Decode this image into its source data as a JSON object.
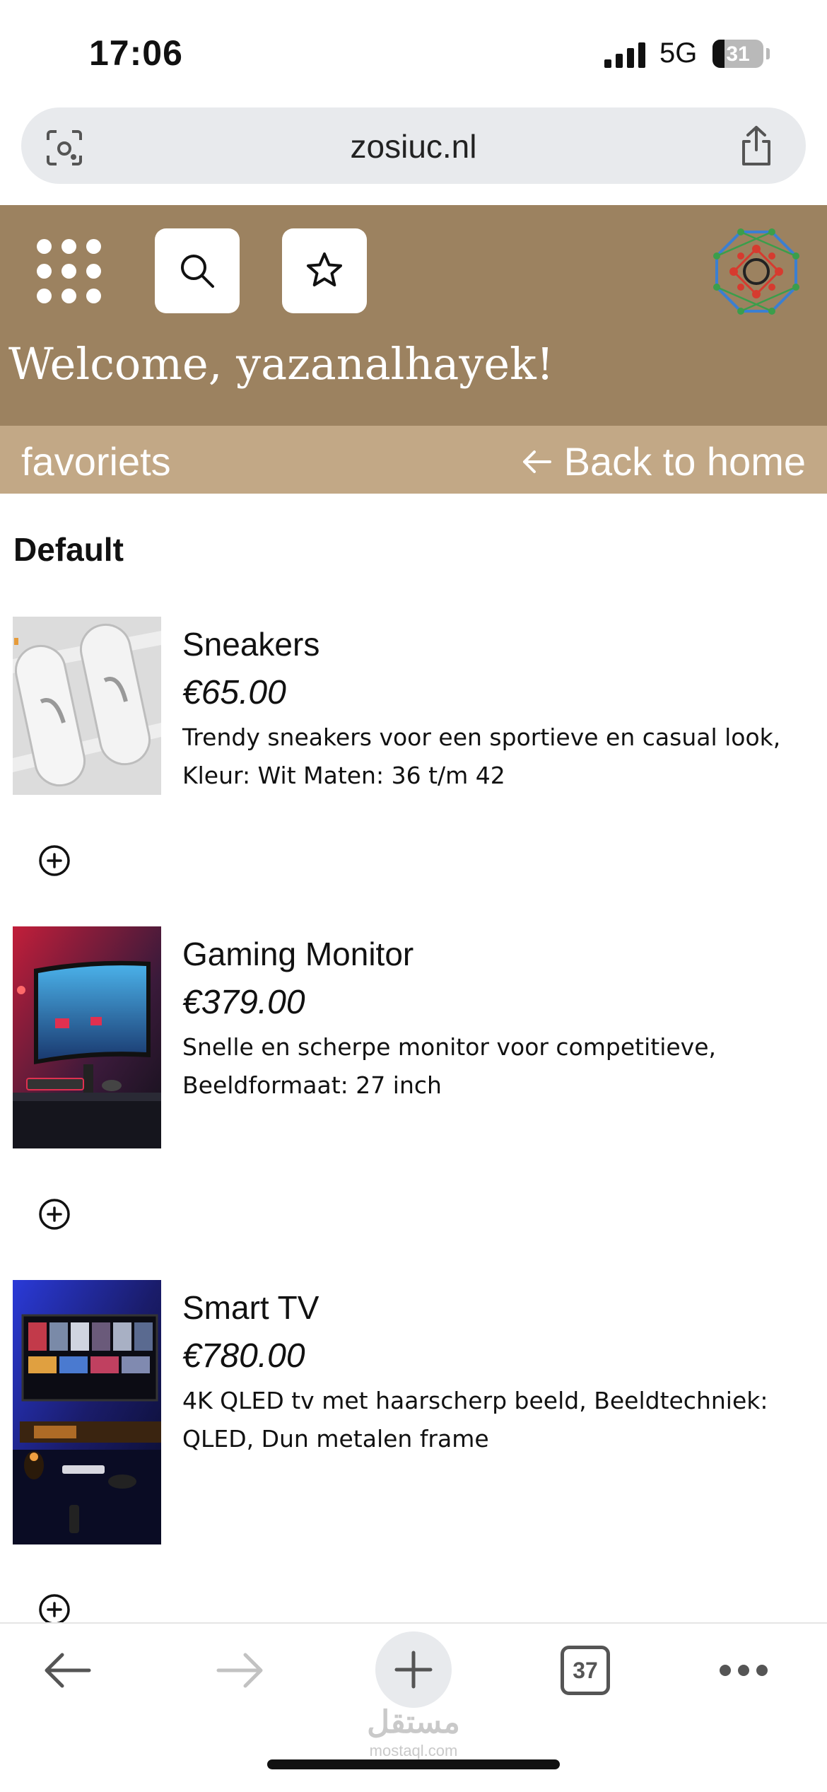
{
  "status_bar": {
    "time": "17:06",
    "network": "5G",
    "battery": "31"
  },
  "browser": {
    "url": "zosiuc.nl",
    "tab_count": "37"
  },
  "header": {
    "welcome": "Welcome, yazanalhayek!"
  },
  "subnav": {
    "title": "favoriets",
    "back_label": "Back to home"
  },
  "section": {
    "title": "Default"
  },
  "products": [
    {
      "name": "Sneakers",
      "price": "€65.00",
      "description": "Trendy sneakers voor een sportieve en casual look, Kleur: Wit Maten: 36 t/m 42"
    },
    {
      "name": "Gaming Monitor",
      "price": "€379.00",
      "description": "Snelle en scherpe monitor voor competitieve, Beeldformaat: 27 inch"
    },
    {
      "name": "Smart TV",
      "price": "€780.00",
      "description": "4K QLED tv met haarscherp beeld, Beeldtechniek: QLED, Dun metalen frame"
    }
  ],
  "watermark": {
    "arabic": "مستقل",
    "latin": "mostaql.com"
  },
  "colors": {
    "header_bg": "#9c8260",
    "subnav_bg": "#c2a886"
  }
}
